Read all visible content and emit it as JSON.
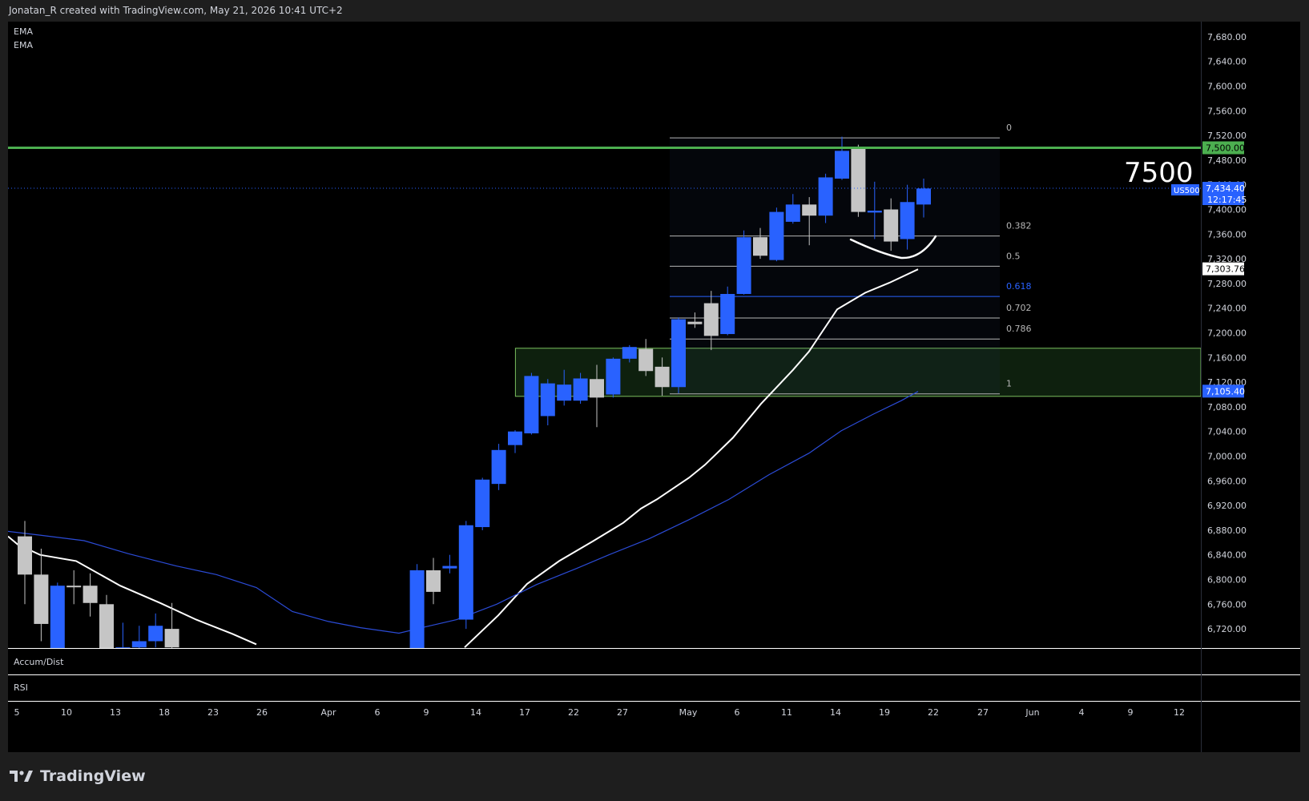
{
  "header": {
    "text": "Jonatan_R created with TradingView.com, May 21, 2026 10:41 UTC+2"
  },
  "footer": {
    "brand": "TradingView"
  },
  "panes": {
    "indicators": [
      "EMA",
      "EMA"
    ],
    "accum_label": "Accum/Dist",
    "rsi_label": "RSI"
  },
  "overlays": {
    "big_label": "7500",
    "symbol_tag": "US500",
    "countdown": "12:17:45"
  },
  "colors": {
    "up": "#2962ff",
    "down": "#c5c5c5",
    "ema_fast": "#ffffff",
    "ema_slow": "#2b4bd6",
    "resistance": "#4caf50",
    "zone_fill": "rgba(76,175,80,0.18)",
    "zone_border": "#7bbf5e"
  },
  "chart_data": {
    "type": "candlestick",
    "symbol": "US500",
    "ylim": [
      6680,
      7720
    ],
    "y_ticks": [
      "7,680.00",
      "7,640.00",
      "7,600.00",
      "7,560.00",
      "7,520.00",
      "7,480.00",
      "7,440.00",
      "7,400.00",
      "7,360.00",
      "7,320.00",
      "7,280.00",
      "7,240.00",
      "7,200.00",
      "7,160.00",
      "7,120.00",
      "7,080.00",
      "7,040.00",
      "7,000.00",
      "6,960.00",
      "6,920.00",
      "6,880.00",
      "6,840.00",
      "6,800.00",
      "6,760.00",
      "6,720.00"
    ],
    "x_ticks": [
      "5",
      "10",
      "13",
      "18",
      "23",
      "26",
      "Apr",
      "6",
      "9",
      "14",
      "17",
      "22",
      "27",
      "May",
      "6",
      "11",
      "14",
      "19",
      "22",
      "27",
      "Jun",
      "4",
      "9",
      "12"
    ],
    "price_labels": [
      {
        "value": 7500.0,
        "text": "7,500.00",
        "style": "green"
      },
      {
        "value": 7434.4,
        "text": "7,434.40",
        "style": "blue"
      },
      {
        "value": 7303.76,
        "text": "7,303.76",
        "style": "white"
      },
      {
        "value": 7105.4,
        "text": "7,105.40",
        "style": "blue"
      }
    ],
    "resistance_level": 7500,
    "current_price": 7434.4,
    "demand_zone": [
      7097,
      7175
    ],
    "fib_levels": [
      {
        "ratio": "0",
        "price": 7516
      },
      {
        "ratio": "0.382",
        "price": 7357
      },
      {
        "ratio": "0.5",
        "price": 7308
      },
      {
        "ratio": "0.618",
        "price": 7259
      },
      {
        "ratio": "0.702",
        "price": 7224
      },
      {
        "ratio": "0.786",
        "price": 7190
      },
      {
        "ratio": "1",
        "price": 7101
      }
    ],
    "candles": [
      {
        "date": "Mar 5",
        "open": 6870,
        "high": 6895,
        "low": 6760,
        "close": 6808
      },
      {
        "date": "Mar 6",
        "open": 6808,
        "high": 6850,
        "low": 6700,
        "close": 6728
      },
      {
        "date": "Mar 9",
        "open": 6675,
        "high": 6795,
        "low": 6640,
        "close": 6790
      },
      {
        "date": "Mar 10",
        "open": 6790,
        "high": 6815,
        "low": 6760,
        "close": 6788
      },
      {
        "date": "Mar 11",
        "open": 6790,
        "high": 6810,
        "low": 6740,
        "close": 6762
      },
      {
        "date": "Mar 12",
        "open": 6760,
        "high": 6775,
        "low": 6640,
        "close": 6680
      },
      {
        "date": "Mar 13",
        "open": 6660,
        "high": 6730,
        "low": 6640,
        "close": 6690
      },
      {
        "date": "Mar 16",
        "open": 6690,
        "high": 6725,
        "low": 6660,
        "close": 6700
      },
      {
        "date": "Mar 17",
        "open": 6700,
        "high": 6745,
        "low": 6690,
        "close": 6725
      },
      {
        "date": "Mar 18",
        "open": 6720,
        "high": 6762,
        "low": 6660,
        "close": 6690
      },
      {
        "date": "Apr 8",
        "open": 6685,
        "high": 6825,
        "low": 6650,
        "close": 6815
      },
      {
        "date": "Apr 9",
        "open": 6815,
        "high": 6835,
        "low": 6760,
        "close": 6780
      },
      {
        "date": "Apr 10",
        "open": 6818,
        "high": 6840,
        "low": 6810,
        "close": 6822
      },
      {
        "date": "Apr 13",
        "open": 6735,
        "high": 6895,
        "low": 6720,
        "close": 6888
      },
      {
        "date": "Apr 14",
        "open": 6885,
        "high": 6965,
        "low": 6880,
        "close": 6962
      },
      {
        "date": "Apr 15",
        "open": 6955,
        "high": 7020,
        "low": 6945,
        "close": 7010
      },
      {
        "date": "Apr 16",
        "open": 7018,
        "high": 7042,
        "low": 7005,
        "close": 7040
      },
      {
        "date": "Apr 17",
        "open": 7037,
        "high": 7135,
        "low": 7035,
        "close": 7130
      },
      {
        "date": "Apr 20",
        "open": 7065,
        "high": 7125,
        "low": 7050,
        "close": 7118
      },
      {
        "date": "Apr 21",
        "open": 7090,
        "high": 7140,
        "low": 7082,
        "close": 7116
      },
      {
        "date": "Apr 22",
        "open": 7090,
        "high": 7135,
        "low": 7085,
        "close": 7126
      },
      {
        "date": "Apr 23",
        "open": 7125,
        "high": 7148,
        "low": 7047,
        "close": 7095
      },
      {
        "date": "Apr 24",
        "open": 7100,
        "high": 7160,
        "low": 7095,
        "close": 7158
      },
      {
        "date": "Apr 27",
        "open": 7158,
        "high": 7180,
        "low": 7152,
        "close": 7177
      },
      {
        "date": "Apr 28",
        "open": 7174,
        "high": 7190,
        "low": 7130,
        "close": 7138
      },
      {
        "date": "Apr 29",
        "open": 7145,
        "high": 7160,
        "low": 7098,
        "close": 7112
      },
      {
        "date": "Apr 30",
        "open": 7112,
        "high": 7225,
        "low": 7102,
        "close": 7222
      },
      {
        "date": "May 1",
        "open": 7218,
        "high": 7233,
        "low": 7208,
        "close": 7214
      },
      {
        "date": "May 4",
        "open": 7248,
        "high": 7268,
        "low": 7172,
        "close": 7195
      },
      {
        "date": "May 5",
        "open": 7198,
        "high": 7275,
        "low": 7196,
        "close": 7263
      },
      {
        "date": "May 6",
        "open": 7263,
        "high": 7366,
        "low": 7262,
        "close": 7355
      },
      {
        "date": "May 7",
        "open": 7355,
        "high": 7370,
        "low": 7320,
        "close": 7325
      },
      {
        "date": "May 8",
        "open": 7318,
        "high": 7403,
        "low": 7316,
        "close": 7396
      },
      {
        "date": "May 11",
        "open": 7380,
        "high": 7425,
        "low": 7377,
        "close": 7408
      },
      {
        "date": "May 12",
        "open": 7408,
        "high": 7420,
        "low": 7342,
        "close": 7390
      },
      {
        "date": "May 13",
        "open": 7390,
        "high": 7458,
        "low": 7378,
        "close": 7452
      },
      {
        "date": "May 14",
        "open": 7450,
        "high": 7518,
        "low": 7448,
        "close": 7495
      },
      {
        "date": "May 15",
        "open": 7500,
        "high": 7505,
        "low": 7388,
        "close": 7396
      },
      {
        "date": "May 18",
        "open": 7395,
        "high": 7445,
        "low": 7352,
        "close": 7398
      },
      {
        "date": "May 19",
        "open": 7400,
        "high": 7418,
        "low": 7333,
        "close": 7348
      },
      {
        "date": "May 20",
        "open": 7352,
        "high": 7440,
        "low": 7335,
        "close": 7412
      },
      {
        "date": "May 21",
        "open": 7408,
        "high": 7450,
        "low": 7387,
        "close": 7434
      }
    ]
  }
}
